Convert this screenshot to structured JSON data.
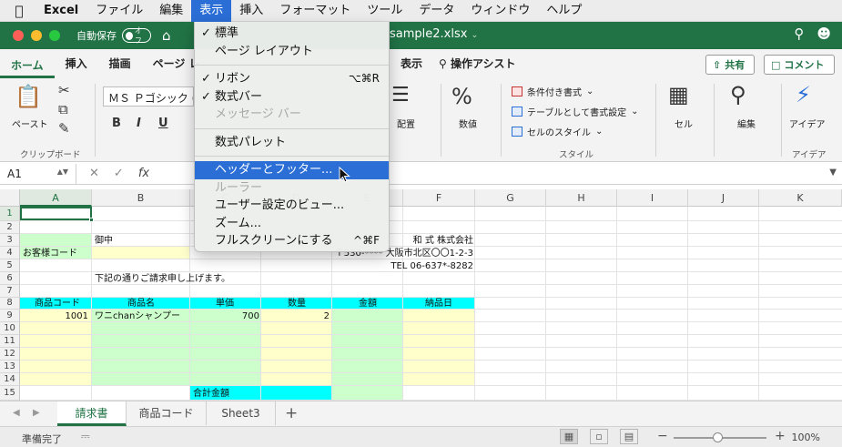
{
  "menubar": {
    "apple": "",
    "app_name": "Excel",
    "items": [
      "ファイル",
      "編集",
      "表示",
      "挿入",
      "フォーマット",
      "ツール",
      "データ",
      "ウィンドウ",
      "ヘルプ"
    ]
  },
  "titlebar": {
    "autosave_label": "自動保存",
    "toggle_label": "オフ",
    "filename": "sample2.xlsx"
  },
  "ribbon_tabs": {
    "home": "ホーム",
    "insert": "挿入",
    "draw": "描画",
    "page": "ページ レ",
    "view": "表示",
    "assist": "操作アシスト",
    "share": "共有",
    "comment": "コメント"
  },
  "ribbon": {
    "paste": "ペースト",
    "clipboard": "クリップボード",
    "font_name": "ＭＳ Ｐゴシック (本",
    "bold": "B",
    "italic": "I",
    "underline": "U",
    "align": "配置",
    "number": "数値",
    "cond_format": "条件付き書式",
    "table_format": "テーブルとして書式設定",
    "cell_style": "セルのスタイル",
    "style_group": "スタイル",
    "cells": "セル",
    "editing": "編集",
    "ideas": "アイデア",
    "ideas_group": "アイデア"
  },
  "formula_bar": {
    "cell_ref": "A1",
    "fx": "fx"
  },
  "grid": {
    "columns": [
      "A",
      "B",
      "C",
      "D",
      "E",
      "F",
      "G",
      "H",
      "I",
      "J",
      "K"
    ],
    "rows": [
      "1",
      "2",
      "3",
      "4",
      "5",
      "6",
      "7",
      "8",
      "9",
      "10",
      "11",
      "12",
      "13",
      "14",
      "15"
    ],
    "cells": {
      "b3": "御中",
      "a4": "お客様コード",
      "company": "和 式 株式会社",
      "address": "〒530-**** 大阪市北区〇〇1-2-3",
      "tel": "TEL 06-637*-8282",
      "b6": "下記の通りご請求申し上げます。",
      "h_code": "商品コード",
      "h_name": "商品名",
      "h_price": "単価",
      "h_qty": "数量",
      "h_amount": "金額",
      "h_date": "納品日",
      "r9_code": "1001",
      "r9_name": "ワニchanシャンプー",
      "r9_price": "700",
      "r9_qty": "2",
      "total_label": "合計金額"
    }
  },
  "sheets": [
    "請求書",
    "商品コード",
    "Sheet3"
  ],
  "status": {
    "text": "準備完了",
    "zoom": "100%"
  },
  "view_menu": {
    "items": [
      {
        "label": "標準",
        "check": "✓",
        "shortcut": ""
      },
      {
        "label": "ページ レイアウト",
        "check": "",
        "shortcut": ""
      },
      {
        "label": "リボン",
        "check": "✓",
        "shortcut": "⌥⌘R"
      },
      {
        "label": "数式バー",
        "check": "✓",
        "shortcut": ""
      },
      {
        "label": "メッセージ バー",
        "check": "",
        "shortcut": ""
      },
      {
        "label": "数式パレット",
        "check": "",
        "shortcut": ""
      },
      {
        "label": "ヘッダーとフッター...",
        "check": "",
        "shortcut": ""
      },
      {
        "label": "ルーラー",
        "check": "",
        "shortcut": ""
      },
      {
        "label": "ユーザー設定のビュー...",
        "check": "",
        "shortcut": ""
      },
      {
        "label": "ズーム...",
        "check": "",
        "shortcut": ""
      },
      {
        "label": "フルスクリーンにする",
        "check": "",
        "shortcut": "^⌘F"
      }
    ]
  },
  "colors": {
    "excel_green": "#217346",
    "menu_highlight": "#2a6ed6",
    "header_cyan": "#00ffff",
    "light_green": "#ccffcc",
    "light_yellow": "#ffffcc"
  }
}
